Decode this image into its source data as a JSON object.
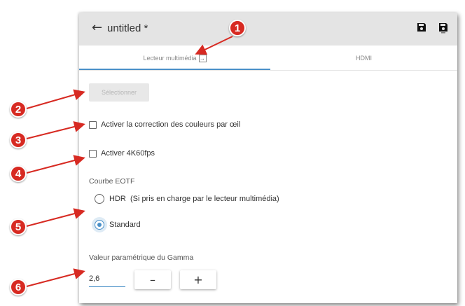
{
  "window": {
    "title": "untitled *",
    "back_icon": "arrow-left-icon",
    "save_icons": [
      "save-icon",
      "save-as-icon"
    ]
  },
  "tabs": [
    {
      "label": "Lecteur multimédia",
      "active": true,
      "icon": "external-link-icon"
    },
    {
      "label": "HDMI",
      "active": false
    }
  ],
  "select_button": {
    "label": "Sélectionner",
    "enabled": false
  },
  "options": {
    "color_correction": {
      "label": "Activer la correction des couleurs par œil",
      "checked": false
    },
    "enable_4k60": {
      "label": "Activer 4K60fps",
      "checked": false
    }
  },
  "eotf": {
    "label": "Courbe EOTF",
    "options": [
      {
        "label": "HDR  (Si pris en charge par le lecteur multimédia)",
        "selected": false
      },
      {
        "label": "Standard",
        "selected": true
      }
    ]
  },
  "gamma": {
    "label": "Valeur paramétrique du Gamma",
    "value": "2,6",
    "minus_label": "–",
    "plus_label": "+"
  },
  "callouts": [
    "1",
    "2",
    "3",
    "4",
    "5",
    "6"
  ],
  "colors": {
    "accent": "#4a90c8",
    "callout": "#d72a22",
    "titlebar": "#e4e4e4"
  }
}
